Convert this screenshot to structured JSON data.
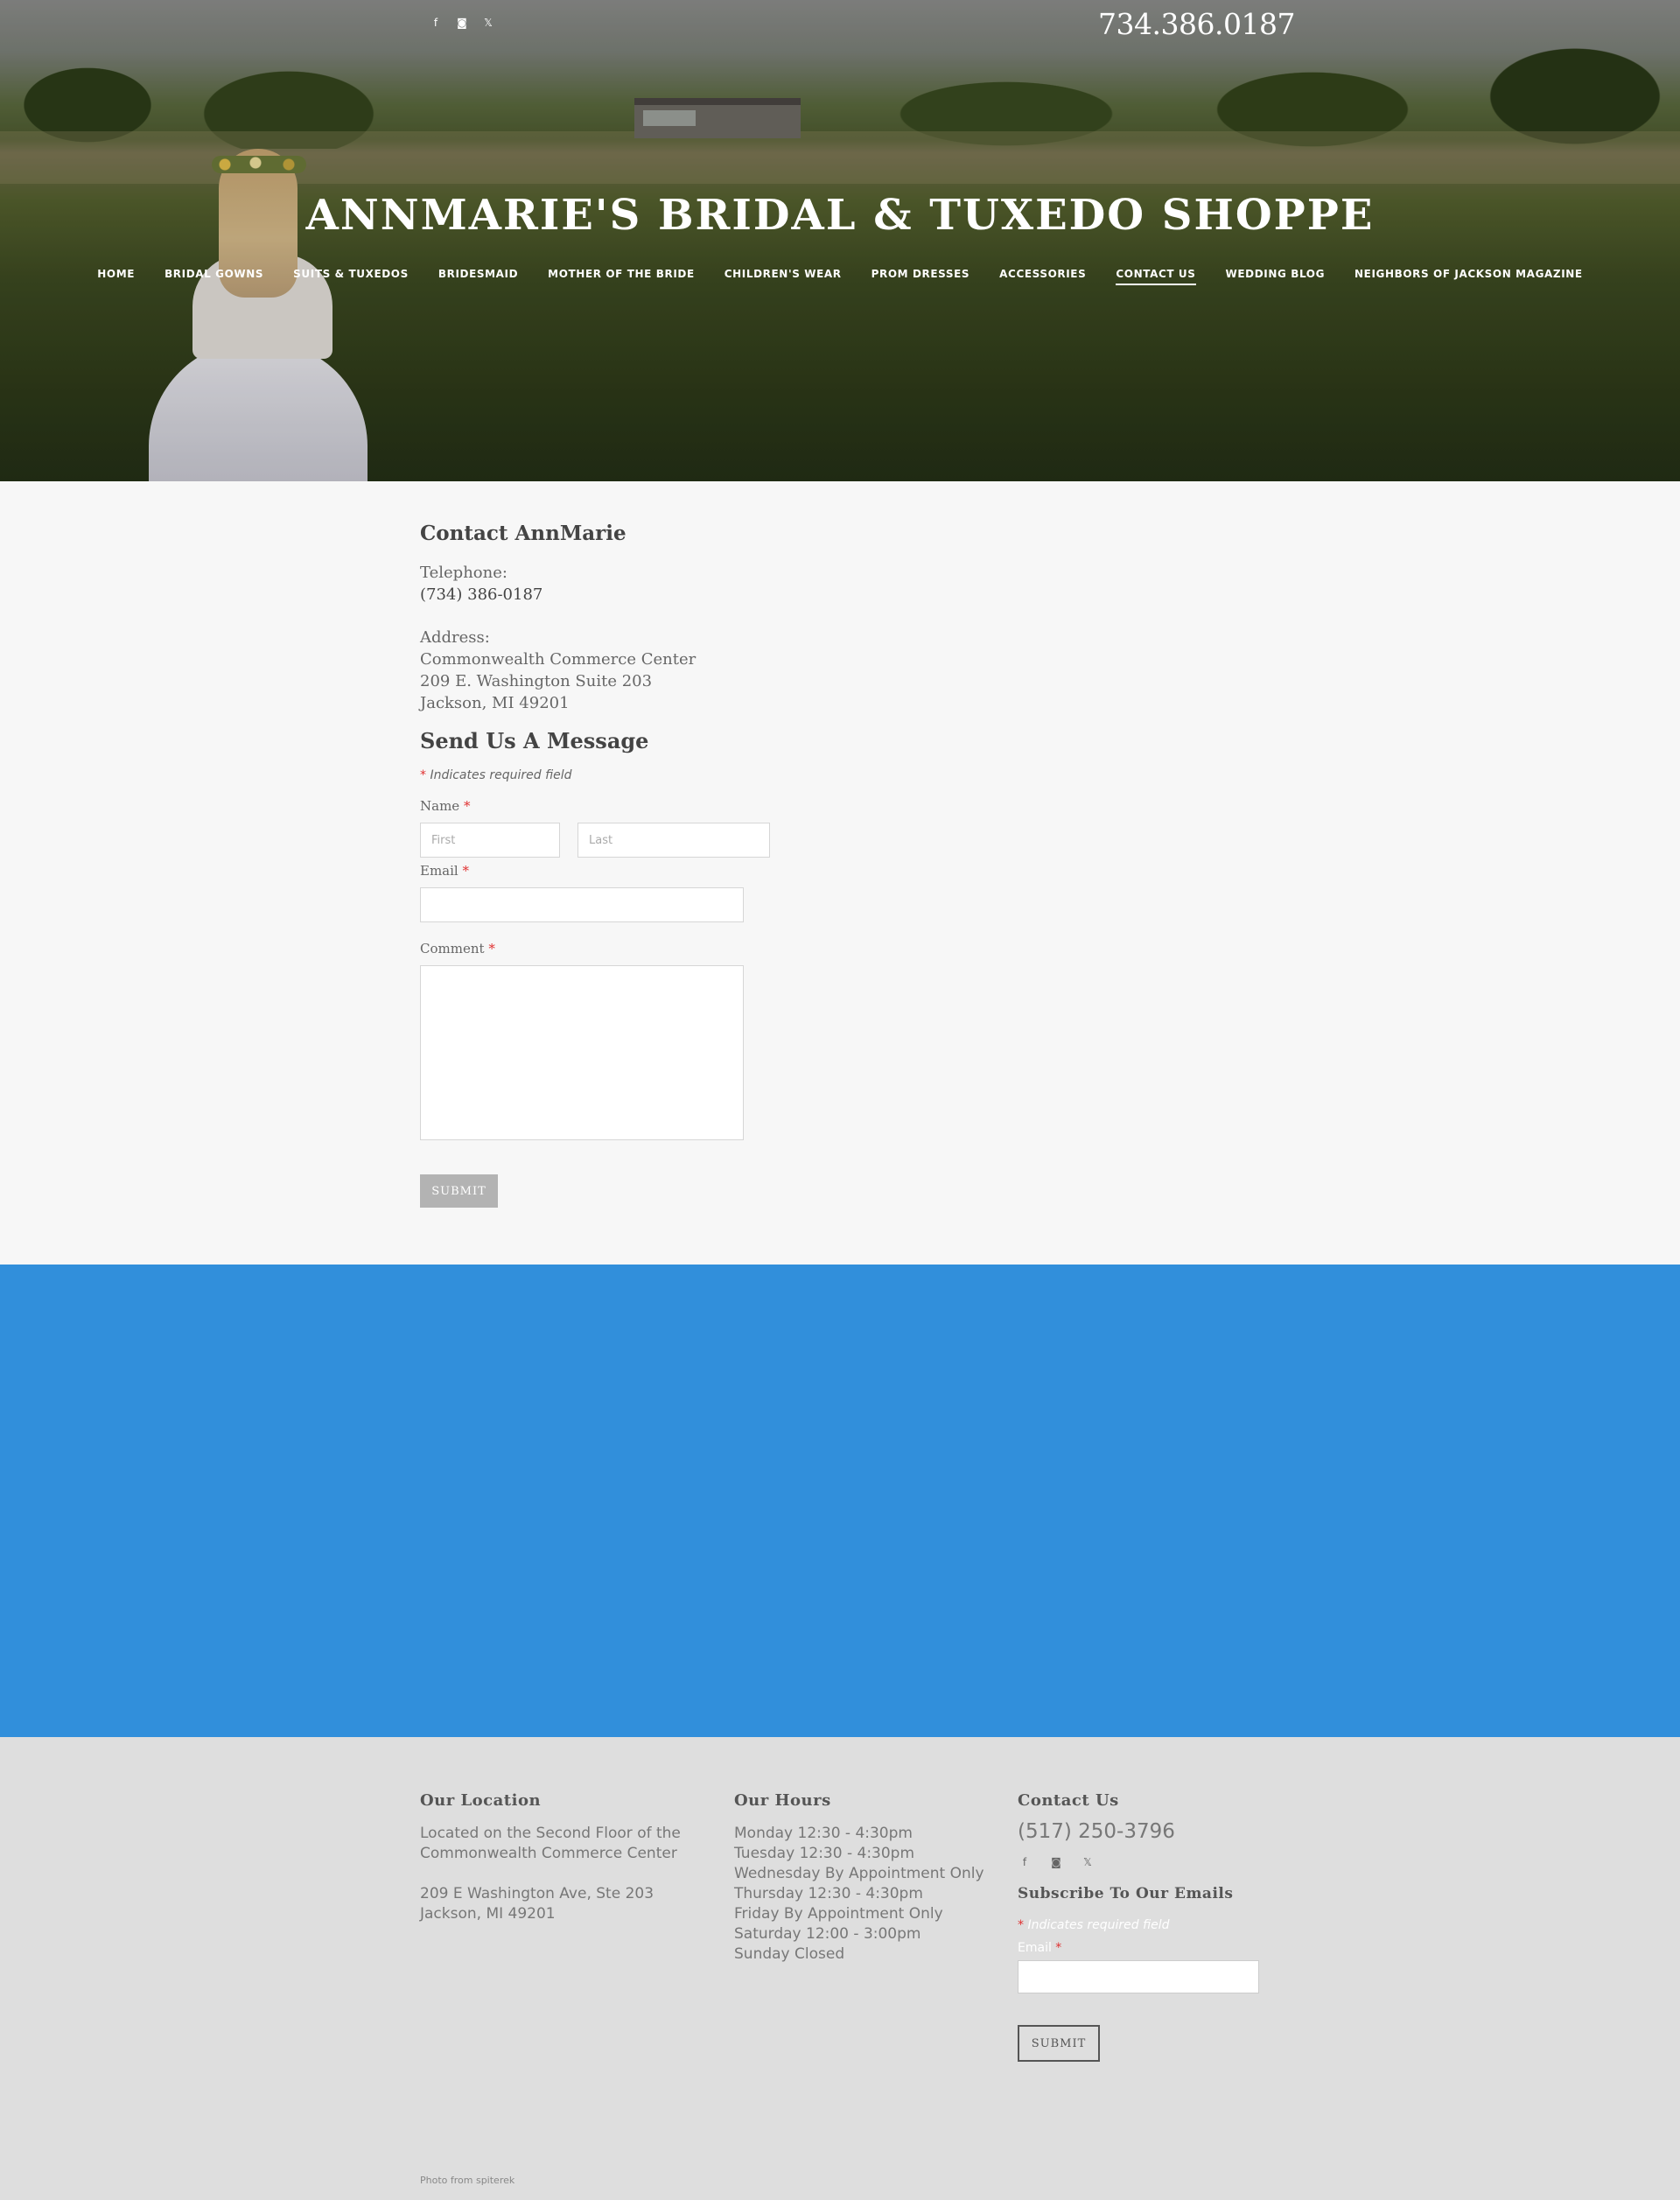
{
  "header": {
    "social_icons": [
      "facebook-icon",
      "instagram-icon",
      "x-icon"
    ],
    "social_glyphs": {
      "facebook": "f",
      "instagram": "◙",
      "x": "𝕏"
    },
    "phone": "734.386.0187",
    "site_title": "ANNMARIE'S BRIDAL & TUXEDO SHOPPE"
  },
  "nav": {
    "items": [
      {
        "label": "HOME"
      },
      {
        "label": "BRIDAL GOWNS"
      },
      {
        "label": "SUITS & TUXEDOS"
      },
      {
        "label": "BRIDESMAID"
      },
      {
        "label": "MOTHER OF THE BRIDE"
      },
      {
        "label": "CHILDREN'S WEAR"
      },
      {
        "label": "PROM DRESSES"
      },
      {
        "label": "ACCESSORIES"
      },
      {
        "label": "CONTACT US",
        "active": true
      },
      {
        "label": "WEDDING BLOG"
      },
      {
        "label": "NEIGHBORS OF JACKSON MAGAZINE"
      }
    ]
  },
  "contact": {
    "title": "Contact AnnMarie",
    "telephone_label": "Telephone:",
    "telephone": "(734) 386-0187",
    "address_label": "Address:",
    "address_lines": [
      "Commonwealth Commerce Center",
      "209 E. Washington Suite 203",
      "Jackson, MI 49201"
    ]
  },
  "form": {
    "title": "Send Us A Message",
    "required_mark": "*",
    "required_note": "Indicates required field",
    "name_label": "Name",
    "first_placeholder": "First",
    "last_placeholder": "Last",
    "email_label": "Email",
    "comment_label": "Comment",
    "submit_label": "SUBMIT"
  },
  "footer": {
    "location": {
      "title": "Our Location",
      "lines": [
        "Located on the Second Floor of the",
        "Commonwealth Commerce Center",
        "",
        "209 E Washington Ave, Ste 203",
        "Jackson, MI 49201"
      ]
    },
    "hours": {
      "title": "Our Hours",
      "lines": [
        "Monday 12:30 - 4:30pm",
        "Tuesday 12:30 - 4:30pm",
        "Wednesday By Appointment Only",
        "Thursday 12:30 - 4:30pm",
        "Friday By Appointment Only",
        "Saturday 12:00 - 3:00pm",
        "Sunday Closed"
      ]
    },
    "contact": {
      "title": "Contact Us",
      "phone": "(517) 250-3796",
      "subscribe_title": "Subscribe To Our Emails",
      "required_note": "Indicates required field",
      "email_label": "Email",
      "submit_label": "SUBMIT"
    },
    "photo_credit": "Photo from spiterek"
  },
  "colors": {
    "band_blue": "#318fdb",
    "required_red": "#e03030",
    "footer_bg": "#dedede"
  }
}
